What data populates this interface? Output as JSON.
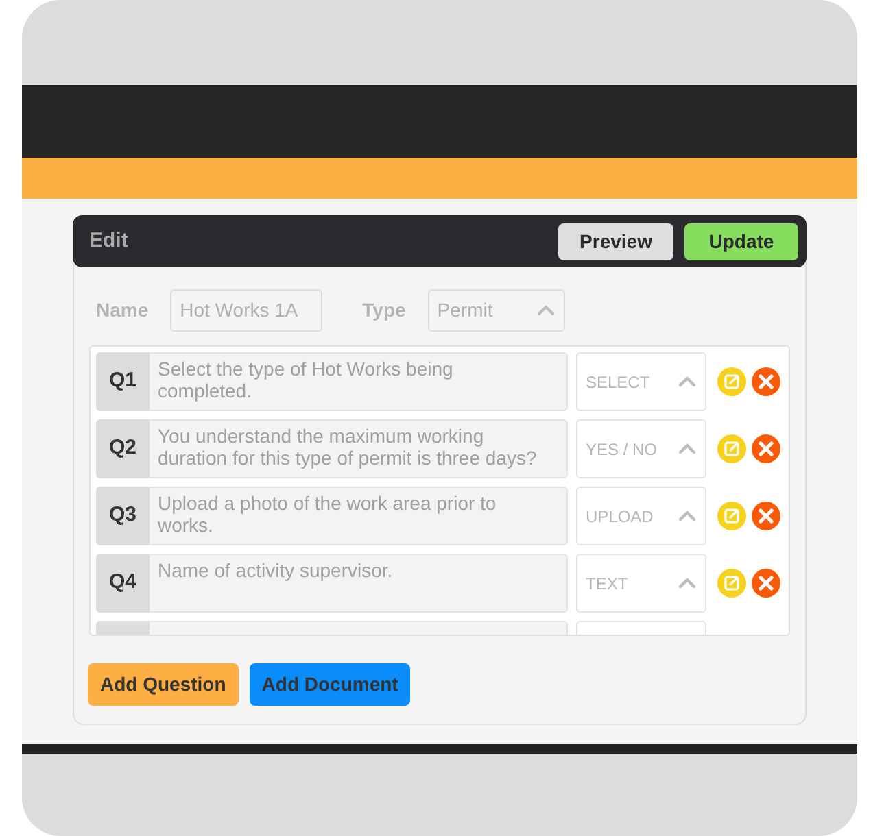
{
  "header": {
    "title": "Edit",
    "buttons": [
      {
        "label": "Preview",
        "kind": "secondary"
      },
      {
        "label": "Update",
        "kind": "success"
      }
    ]
  },
  "form": {
    "name_label": "Name",
    "name_value": "Hot Works 1A",
    "type_label": "Type",
    "type_value": "Permit"
  },
  "questions": [
    {
      "number": "Q1",
      "text": "Select the type of Hot Works being completed.",
      "type": "SELECT"
    },
    {
      "number": "Q2",
      "text": "You understand the maximum working duration for this type of permit is three days?",
      "type": "YES / NO"
    },
    {
      "number": "Q3",
      "text": "Upload a photo of the work area prior to works.",
      "type": "UPLOAD"
    },
    {
      "number": "Q4",
      "text": "Name of activity supervisor.",
      "type": "TEXT"
    }
  ],
  "footer_buttons": [
    {
      "label": "Add Question",
      "kind": "warning"
    },
    {
      "label": "Add Document",
      "kind": "primary"
    }
  ]
}
